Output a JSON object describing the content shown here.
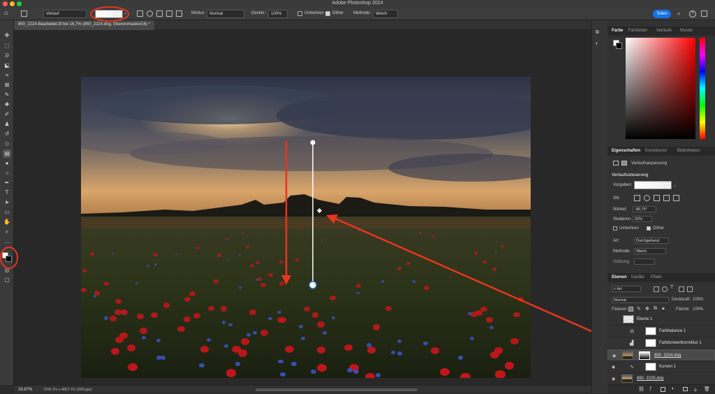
{
  "app": {
    "title": "Adobe Photoshop 2024"
  },
  "options_bar": {
    "tool_name": "Verlauf",
    "mode_label": "Modus:",
    "mode_value": "Normal",
    "opacity_label": "Deckkr.:",
    "opacity_value": "100%",
    "reverse_label": "Umkehren",
    "dither_label": "Dither",
    "method_label": "Methode:",
    "method_value": "Weich",
    "share_label": "Teilen"
  },
  "document": {
    "tab_title": "850_2224-Bearbeitet.tif bei 16,7% (850_2224.dng, Ebenenmaske/16) *",
    "zoom": "16.67%",
    "info": "7241 Px x 4827 Px (300 ppi)"
  },
  "color_panel": {
    "tabs": [
      "Farbe",
      "Farbfelder",
      "Verläufe",
      "Muster"
    ],
    "hue_color": "#ff0000"
  },
  "properties_panel": {
    "tabs": [
      "Eigenschaften",
      "Korrekturen",
      "Bibliotheken"
    ],
    "subtitle": "Verlaufsanpassung",
    "section": "Verlaufssteuerung",
    "preset_label": "Vorgaben:",
    "style_label": "Stil:",
    "angle_label": "Winkel:",
    "angle_value": "-89,76°",
    "scale_label": "Skalieren:",
    "scale_value": "32%",
    "reverse_label": "Umkehren",
    "dither_label": "Dither",
    "type_label": "Art:",
    "type_value": "Durchgehend",
    "method_label": "Methode:",
    "method_value": "Weich",
    "smooth_label": "Glättung:"
  },
  "layers_panel": {
    "tabs": [
      "Ebenen",
      "Kanäle",
      "Pfade"
    ],
    "filter_label": "Art",
    "blend_mode": "Normal",
    "opacity_label": "Deckkraft:",
    "opacity_value": "100%",
    "lock_label": "Fixieren:",
    "fill_label": "Fläche:",
    "fill_value": "100%",
    "layers": [
      {
        "name": "Ebene 1"
      },
      {
        "name": "Farbbalance 1"
      },
      {
        "name": "Farbtonwertkorrektur 1"
      },
      {
        "name": "850_2224.dng"
      },
      {
        "name": "Kurven 1"
      },
      {
        "name": "850_2225.dng"
      }
    ]
  },
  "annotation": {
    "color": "#e8351e"
  }
}
